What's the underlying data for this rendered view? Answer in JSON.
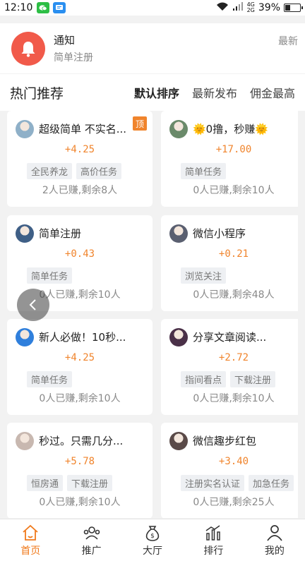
{
  "status": {
    "time": "12:10",
    "network_label": "4G",
    "network_label2": "2G",
    "battery": "39%",
    "battery_level": 0.39
  },
  "notice": {
    "title": "通知",
    "subtitle": "简单注册",
    "latest": "最新"
  },
  "section": {
    "title": "热门推荐",
    "sort_tabs": [
      "默认排序",
      "最新发布",
      "佣金最高"
    ],
    "active_sort": "默认排序"
  },
  "cards": [
    {
      "title": "超级简单  不实名...",
      "price": "+4.25",
      "tags": [
        "全民养龙",
        "高价任务"
      ],
      "stat": "2人已赚,剩余8人",
      "badge": "顶",
      "avatar_color": "#8fb0c8"
    },
    {
      "title": "🌞0撸，秒赚🌞",
      "price": "+17.00",
      "tags": [
        "简单任务"
      ],
      "stat": "0人已赚,剩余10人",
      "badge": "",
      "avatar_color": "#6a8a6a"
    },
    {
      "title": "简单注册",
      "price": "+0.43",
      "tags": [
        "简单任务"
      ],
      "stat": "0人已赚,剩余10人",
      "badge": "",
      "avatar_color": "#3f5f86"
    },
    {
      "title": "微信小程序",
      "price": "+0.21",
      "tags": [
        "浏览关注"
      ],
      "stat": "0人已赚,剩余48人",
      "badge": "",
      "avatar_color": "#5a5f70"
    },
    {
      "title": "新人必做！10秒...",
      "price": "+4.25",
      "tags": [
        "简单任务"
      ],
      "stat": "0人已赚,剩余10人",
      "badge": "",
      "avatar_color": "#2f7fdc"
    },
    {
      "title": "分享文章阅读...",
      "price": "+2.72",
      "tags": [
        "指间看点",
        "下载注册"
      ],
      "stat": "0人已赚,剩余10人",
      "badge": "",
      "avatar_color": "#4a3048"
    },
    {
      "title": "秒过。只需几分...",
      "price": "+5.78",
      "tags": [
        "恒房通",
        "下载注册"
      ],
      "stat": "0人已赚,剩余10人",
      "badge": "",
      "avatar_color": "#c8b8b0"
    },
    {
      "title": "微信趣步红包",
      "price": "+3.40",
      "tags": [
        "注册实名认证",
        "加急任务"
      ],
      "stat": "0人已赚,剩余25人",
      "badge": "",
      "avatar_color": "#5a4a48"
    }
  ],
  "tabbar": [
    {
      "label": "首页",
      "icon": "home-icon",
      "active": true
    },
    {
      "label": "推广",
      "icon": "promote-icon",
      "active": false
    },
    {
      "label": "大厅",
      "icon": "money-bag-icon",
      "active": false
    },
    {
      "label": "排行",
      "icon": "ranking-icon",
      "active": false
    },
    {
      "label": "我的",
      "icon": "user-icon",
      "active": false
    }
  ],
  "colors": {
    "accent": "#f07a1c",
    "price": "#f0842c",
    "bell_bg": "#f15a4a"
  }
}
